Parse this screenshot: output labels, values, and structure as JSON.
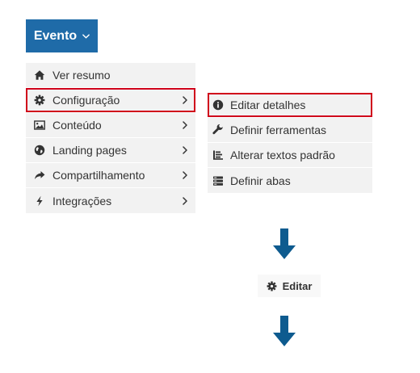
{
  "header": {
    "dropdown_label": "Evento"
  },
  "menu": {
    "items": [
      {
        "label": "Ver resumo",
        "icon": "home-icon",
        "has_submenu": false
      },
      {
        "label": "Configuração",
        "icon": "gear-icon",
        "has_submenu": true,
        "highlighted": true
      },
      {
        "label": "Conteúdo",
        "icon": "image-icon",
        "has_submenu": true
      },
      {
        "label": "Landing pages",
        "icon": "globe-icon",
        "has_submenu": true
      },
      {
        "label": "Compartilhamento",
        "icon": "share-icon",
        "has_submenu": true
      },
      {
        "label": "Integrações",
        "icon": "bolt-icon",
        "has_submenu": true
      }
    ]
  },
  "submenu": {
    "items": [
      {
        "label": "Editar detalhes",
        "icon": "info-circle-icon",
        "highlighted": true
      },
      {
        "label": "Definir ferramentas",
        "icon": "wrench-icon"
      },
      {
        "label": "Alterar textos padrão",
        "icon": "text-lines-icon"
      },
      {
        "label": "Definir abas",
        "icon": "tabs-icon"
      }
    ]
  },
  "action": {
    "edit_label": "Editar",
    "icon": "gear-icon"
  },
  "colors": {
    "primary": "#1f6ba8",
    "arrow": "#0e5b8f",
    "highlight_border": "#d0021b",
    "menu_bg": "#f2f2f2"
  }
}
